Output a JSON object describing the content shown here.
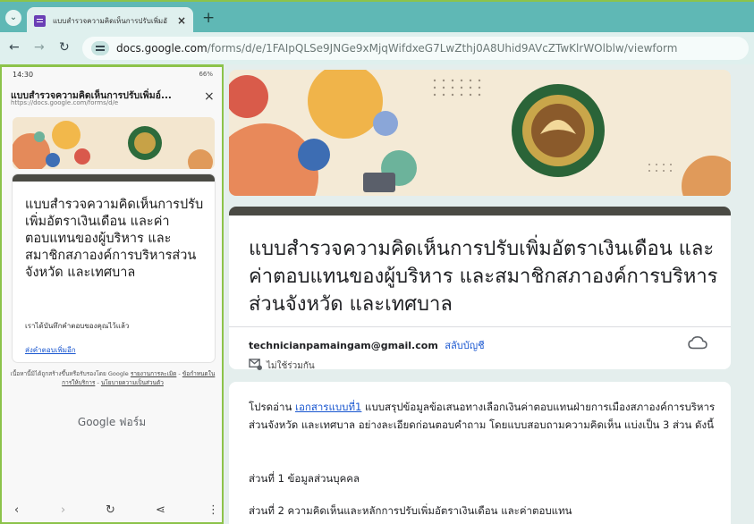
{
  "browser": {
    "tab_title": "แบบสำรวจความคิดเห็นการปรับเพิ่มอั",
    "tab_close": "×",
    "new_tab": "+",
    "url_host": "docs.google.com",
    "url_path": "/forms/d/e/1FAIpQLSe9JNGe9xMjqWifdxeG7LwZthj0A8Uhid9AVcZTwKlrWOlblw/viewform",
    "colors": {
      "tabbar": "#5fb8b5",
      "toolbar": "#dff0ee",
      "phone_border": "#8cc34a"
    }
  },
  "phone": {
    "status_time": "14:30",
    "status_right": "66%",
    "sheet_title": "แบบสำรวจความคิดเห็นการปรับเพิ่มอ์...",
    "sheet_url": "https://docs.google.com/forms/d/e",
    "close": "×",
    "heading": "แบบสำรวจความคิดเห็นการปรับเพิ่มอัตราเงินเดือน และค่าตอบแทนของผู้บริหาร และสมาชิกสภาองค์การบริหารส่วนจังหวัด และเทศบาล",
    "response_recorded": "เราได้บันทึกคำตอบของคุณไว้แล้ว",
    "submit_another": "ส่งคำตอบเพิ่มอีก",
    "footer_text": "เนื้อหานี้มิได้ถูกสร้างขึ้นหรือรับรองโดย Google",
    "footer_links": [
      "รายงานการละเมิด",
      "ข้อกำหนดในการให้บริการ",
      "นโยบายความเป็นส่วนตัว"
    ],
    "brand_google": "Google",
    "brand_forms": "ฟอร์ม"
  },
  "form": {
    "title": "แบบสำรวจความคิดเห็นการปรับเพิ่มอัตราเงินเดือน และค่าตอบแทนของผู้บริหาร และสมาชิกสภาองค์การบริหารส่วนจังหวัด และเทศบาล",
    "account_email": "technicianpamaingam@gmail.com",
    "switch_account": "สลับบัญชี",
    "not_shared": "ไม่ใช้ร่วมกัน",
    "desc_intro": "โปรดอ่าน ",
    "desc_link": "เอกสารแบบที่1",
    "desc_rest": " แบบสรุปข้อมูลข้อเสนอทางเลือกเงินค่าตอบแทนฝ่ายการเมืองสภาองค์การบริหารส่วนจังหวัด และเทศบาล อย่างละเอียดก่อนตอบคำถาม โดยแบบสอบถามความคิดเห็น แบ่งเป็น 3 ส่วน ดังนี้",
    "part1": "ส่วนที่ 1 ข้อมูลส่วนบุคคล",
    "part2": "ส่วนที่ 2 ความคิดเห็นและหลักการปรับเพิ่มอัตราเงินเดือน และค่าตอบแทน",
    "accent": "#4a4a44",
    "link_color": "#1a57d0"
  }
}
